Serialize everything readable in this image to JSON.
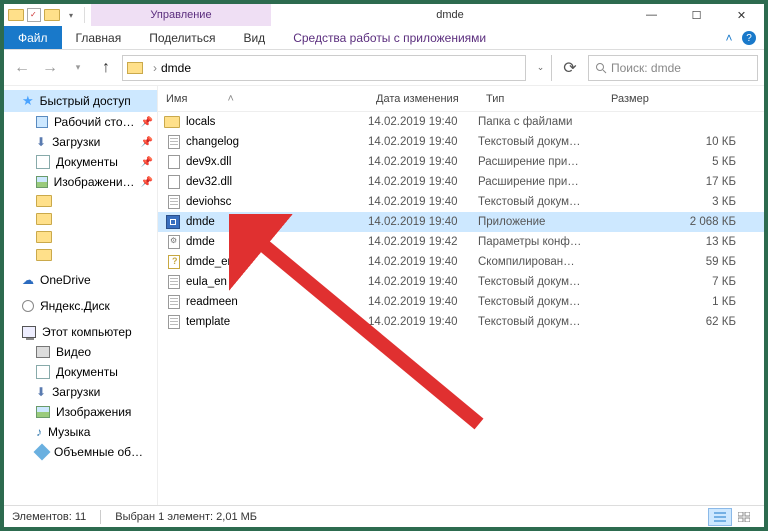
{
  "titlebar": {
    "tool_tab": "Управление",
    "title": "dmde"
  },
  "ribbon": {
    "file": "Файл",
    "home": "Главная",
    "share": "Поделиться",
    "view": "Вид",
    "apptools": "Средства работы с приложениями"
  },
  "address": {
    "folder": "dmde"
  },
  "search": {
    "placeholder": "Поиск: dmde"
  },
  "columns": {
    "name": "Имя",
    "date": "Дата изменения",
    "type": "Тип",
    "size": "Размер"
  },
  "nav": {
    "quick": "Быстрый доступ",
    "desktop": "Рабочий сто…",
    "downloads": "Загрузки",
    "documents": "Документы",
    "pictures": "Изображени…",
    "onedrive": "OneDrive",
    "yandex": "Яндекс.Диск",
    "thispc": "Этот компьютер",
    "videos": "Видео",
    "documents2": "Документы",
    "downloads2": "Загрузки",
    "pictures2": "Изображения",
    "music": "Музыка",
    "volumes": "Объемные об…"
  },
  "files": [
    {
      "name": "locals",
      "date": "14.02.2019 19:40",
      "type": "Папка с файлами",
      "size": "",
      "icon": "folder",
      "sel": false
    },
    {
      "name": "changelog",
      "date": "14.02.2019 19:40",
      "type": "Текстовый докум…",
      "size": "10 КБ",
      "icon": "txt",
      "sel": false
    },
    {
      "name": "dev9x.dll",
      "date": "14.02.2019 19:40",
      "type": "Расширение при…",
      "size": "5 КБ",
      "icon": "dll",
      "sel": false
    },
    {
      "name": "dev32.dll",
      "date": "14.02.2019 19:40",
      "type": "Расширение при…",
      "size": "17 КБ",
      "icon": "dll",
      "sel": false
    },
    {
      "name": "deviohsc",
      "date": "14.02.2019 19:40",
      "type": "Текстовый докум…",
      "size": "3 КБ",
      "icon": "txt",
      "sel": false
    },
    {
      "name": "dmde",
      "date": "14.02.2019 19:40",
      "type": "Приложение",
      "size": "2 068 КБ",
      "icon": "app",
      "sel": true
    },
    {
      "name": "dmde",
      "date": "14.02.2019 19:42",
      "type": "Параметры конф…",
      "size": "13 КБ",
      "icon": "cfg",
      "sel": false
    },
    {
      "name": "dmde_en",
      "date": "14.02.2019 19:40",
      "type": "Скомпилирован…",
      "size": "59 КБ",
      "icon": "chm",
      "sel": false
    },
    {
      "name": "eula_en",
      "date": "14.02.2019 19:40",
      "type": "Текстовый докум…",
      "size": "7 КБ",
      "icon": "txt",
      "sel": false
    },
    {
      "name": "readmeen",
      "date": "14.02.2019 19:40",
      "type": "Текстовый докум…",
      "size": "1 КБ",
      "icon": "txt",
      "sel": false
    },
    {
      "name": "template",
      "date": "14.02.2019 19:40",
      "type": "Текстовый докум…",
      "size": "62 КБ",
      "icon": "txt",
      "sel": false
    }
  ],
  "status": {
    "count": "Элементов: 11",
    "selected": "Выбран 1 элемент: 2,01 МБ"
  }
}
